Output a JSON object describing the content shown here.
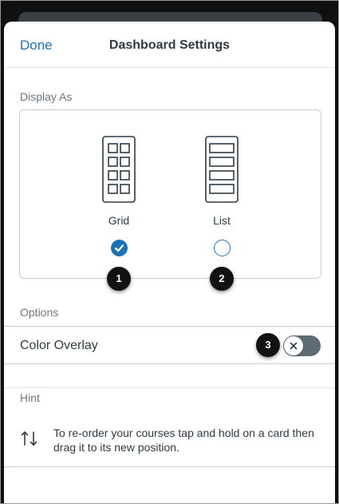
{
  "header": {
    "done_label": "Done",
    "title": "Dashboard Settings"
  },
  "display_as": {
    "label": "Display As",
    "options": [
      {
        "label": "Grid",
        "icon": "grid-layout-icon",
        "selected": true
      },
      {
        "label": "List",
        "icon": "list-layout-icon",
        "selected": false
      }
    ]
  },
  "options_section": {
    "label": "Options",
    "color_overlay": {
      "label": "Color Overlay",
      "enabled": false
    }
  },
  "hint": {
    "label": "Hint",
    "icon": "reorder-arrows-icon",
    "text": "To re-order your courses tap and hold on a card then drag it to its new position."
  },
  "callouts": [
    "1",
    "2",
    "3"
  ],
  "colors": {
    "accent": "#1a73b8",
    "text": "#2d3b45",
    "muted": "#6b7780",
    "toggle_off": "#5d6b74"
  }
}
